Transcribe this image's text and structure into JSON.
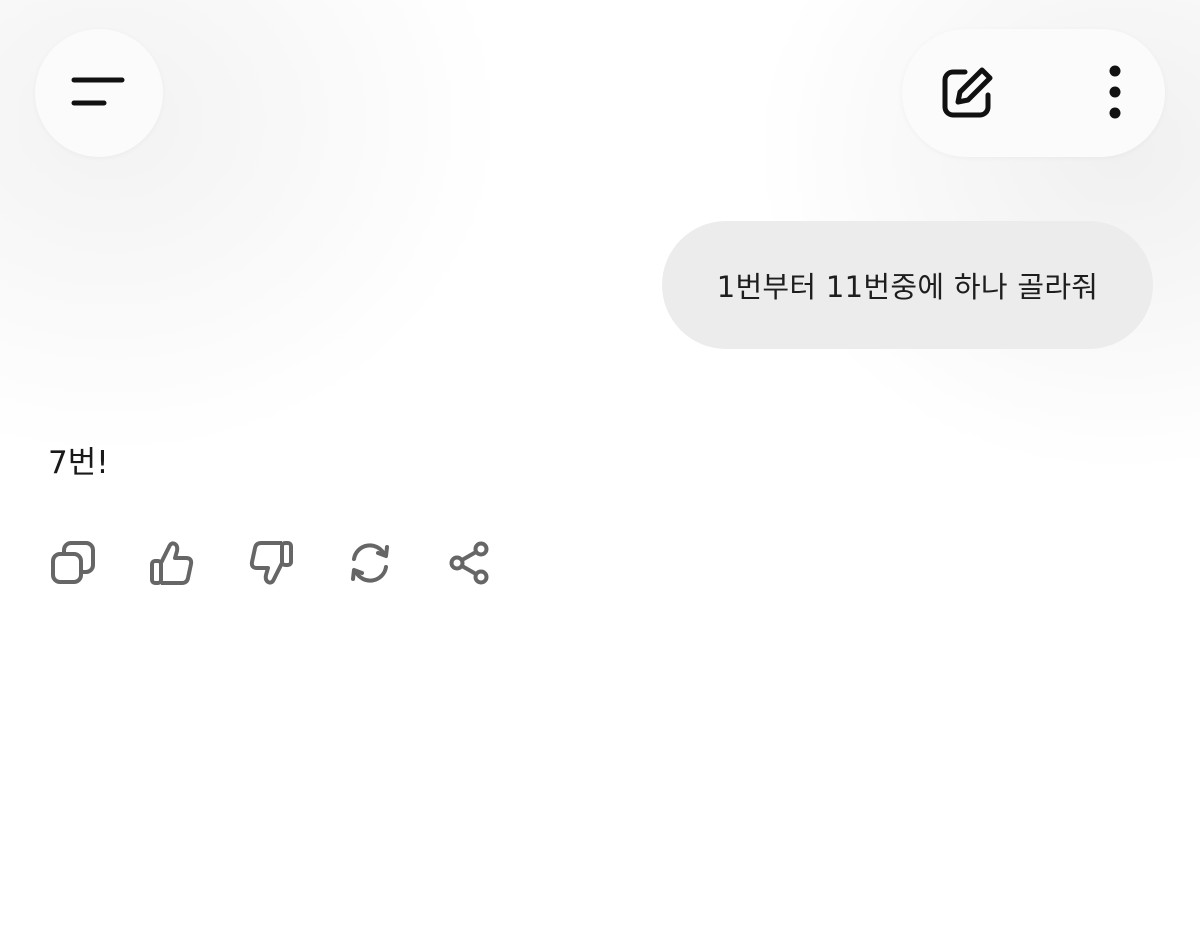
{
  "header": {
    "menu_icon": "menu-lines-icon",
    "new_chat_icon": "edit-pencil-icon",
    "more_icon": "more-vertical-icon"
  },
  "conversation": {
    "user_message": "1번부터 11번중에 하나 골라줘",
    "assistant_message": "7번!"
  },
  "message_actions": [
    {
      "name": "copy",
      "icon": "copy-icon"
    },
    {
      "name": "like",
      "icon": "thumbs-up-icon"
    },
    {
      "name": "dislike",
      "icon": "thumbs-down-icon"
    },
    {
      "name": "regenerate",
      "icon": "refresh-icon"
    },
    {
      "name": "share",
      "icon": "share-icon"
    }
  ],
  "colors": {
    "icon_dark": "#111111",
    "icon_gray": "#666666",
    "user_bubble": "#ececec",
    "button_bg": "#fbfbfb"
  }
}
